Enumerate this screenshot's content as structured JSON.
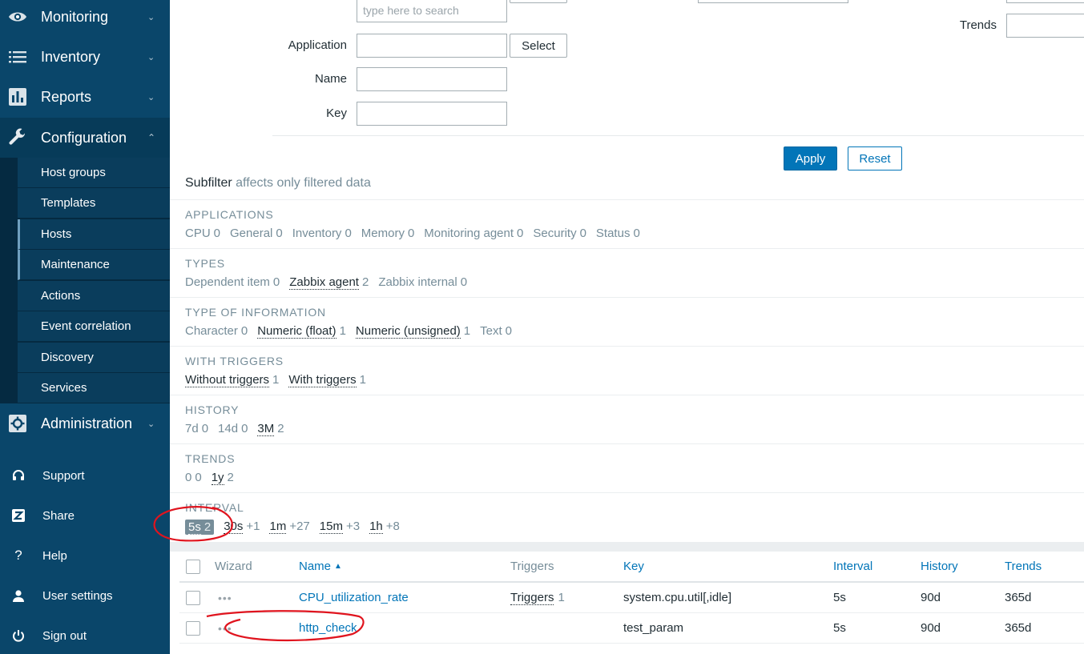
{
  "sidebar": {
    "main": [
      {
        "label": "Monitoring",
        "icon": "eye-icon"
      },
      {
        "label": "Inventory",
        "icon": "list-icon"
      },
      {
        "label": "Reports",
        "icon": "bar-chart-icon"
      },
      {
        "label": "Configuration",
        "icon": "wrench-icon"
      },
      {
        "label": "Administration",
        "icon": "gear-icon"
      }
    ],
    "configuration_submenu": [
      "Host groups",
      "Templates",
      "Hosts",
      "Maintenance",
      "Actions",
      "Event correlation",
      "Discovery",
      "Services"
    ],
    "selected_submenu": "Hosts",
    "secondary": [
      {
        "label": "Support",
        "icon": "headset-icon"
      },
      {
        "label": "Share",
        "icon": "share-z-icon"
      },
      {
        "label": "Help",
        "icon": "help-icon"
      },
      {
        "label": "User settings",
        "icon": "user-icon"
      },
      {
        "label": "Sign out",
        "icon": "power-icon"
      }
    ]
  },
  "filter": {
    "search_placeholder": "type here to search",
    "application_label": "Application",
    "application_value": "",
    "select_label": "Select",
    "name_label": "Name",
    "name_value": "",
    "key_label": "Key",
    "key_value": "",
    "trends_label": "Trends",
    "trends_value": "",
    "apply_label": "Apply",
    "reset_label": "Reset"
  },
  "subfilter": {
    "title": "Subfilter",
    "hint": "affects only filtered data",
    "groups": [
      {
        "heading": "APPLICATIONS",
        "items": [
          {
            "label": "CPU",
            "count": "0"
          },
          {
            "label": "General",
            "count": "0"
          },
          {
            "label": "Inventory",
            "count": "0"
          },
          {
            "label": "Memory",
            "count": "0"
          },
          {
            "label": "Monitoring agent",
            "count": "0"
          },
          {
            "label": "Security",
            "count": "0"
          },
          {
            "label": "Status",
            "count": "0"
          }
        ]
      },
      {
        "heading": "TYPES",
        "items": [
          {
            "label": "Dependent item",
            "count": "0"
          },
          {
            "label": "Zabbix agent",
            "count": "2",
            "link": true
          },
          {
            "label": "Zabbix internal",
            "count": "0"
          }
        ]
      },
      {
        "heading": "TYPE OF INFORMATION",
        "items": [
          {
            "label": "Character",
            "count": "0"
          },
          {
            "label": "Numeric (float)",
            "count": "1",
            "link": true
          },
          {
            "label": "Numeric (unsigned)",
            "count": "1",
            "link": true
          },
          {
            "label": "Text",
            "count": "0"
          }
        ]
      },
      {
        "heading": "WITH TRIGGERS",
        "items": [
          {
            "label": "Without triggers",
            "count": "1",
            "link": true
          },
          {
            "label": "With triggers",
            "count": "1",
            "link": true
          }
        ]
      },
      {
        "heading": "HISTORY",
        "items": [
          {
            "label": "7d",
            "count": "0"
          },
          {
            "label": "14d",
            "count": "0"
          },
          {
            "label": "3M",
            "count": "2",
            "link": true
          }
        ]
      },
      {
        "heading": "TRENDS",
        "items": [
          {
            "label": "0",
            "count": "0"
          },
          {
            "label": "1y",
            "count": "2",
            "link": true
          }
        ]
      },
      {
        "heading": "INTERVAL",
        "items": [
          {
            "label": "5s",
            "count": "2",
            "link": true,
            "selected": true
          },
          {
            "label": "30s",
            "count": "+1",
            "link": true
          },
          {
            "label": "1m",
            "count": "+27",
            "link": true
          },
          {
            "label": "15m",
            "count": "+3",
            "link": true
          },
          {
            "label": "1h",
            "count": "+8",
            "link": true
          }
        ]
      }
    ]
  },
  "table": {
    "headers": {
      "wizard": "Wizard",
      "name": "Name",
      "triggers": "Triggers",
      "key": "Key",
      "interval": "Interval",
      "history": "History",
      "trends": "Trends"
    },
    "rows": [
      {
        "wizard": "•••",
        "name": "CPU_utilization_rate",
        "triggers": "Triggers",
        "trigger_count": "1",
        "key": "system.cpu.util[,idle]",
        "interval": "5s",
        "history": "90d",
        "trends": "365d"
      },
      {
        "wizard": "•••",
        "name": "http_check",
        "triggers": "",
        "trigger_count": "",
        "key": "test_param",
        "interval": "5s",
        "history": "90d",
        "trends": "365d"
      }
    ]
  },
  "colors": {
    "sidebar": "#0a466a",
    "accent": "#0275b8",
    "muted": "#768d99",
    "annotation": "#e0141e"
  }
}
